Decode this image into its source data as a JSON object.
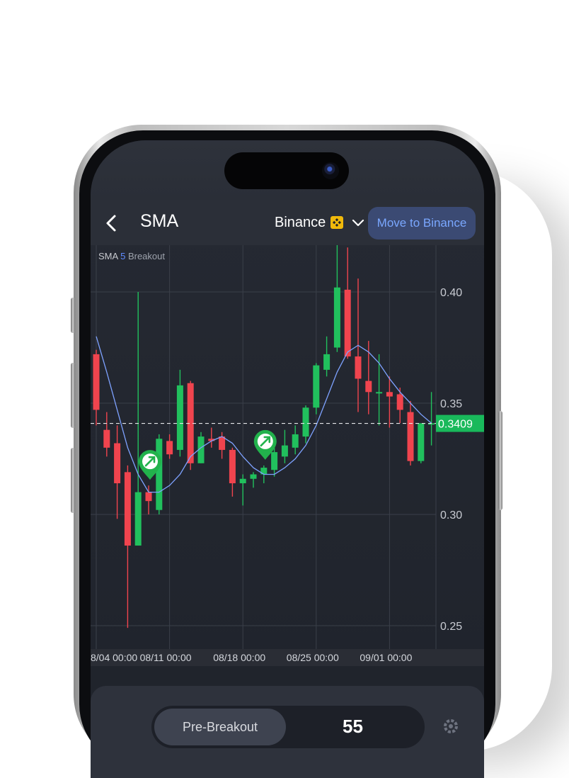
{
  "header": {
    "title": "SMA",
    "exchange": "Binance",
    "move_button": "Move to Binance"
  },
  "indicator": {
    "name": "SMA",
    "period": "5",
    "mode": "Breakout"
  },
  "bottom_panel": {
    "active_segment": "Pre-Breakout",
    "right_value": "55"
  },
  "colors": {
    "up": "#21c05d",
    "down": "#f0444e",
    "sma_line": "#7ea2ff",
    "current_price_tag": "#19b95b",
    "accent": "#7aa7ff"
  },
  "icons": [
    "back-icon",
    "binance-icon",
    "chevron-down-icon",
    "buy-signal-icon",
    "gear-icon"
  ],
  "chart_data": {
    "type": "candlestick",
    "title": "",
    "y_ticks": [
      "0.40",
      "0.35",
      "0.30",
      "0.25"
    ],
    "ylim": [
      0.245,
      0.455
    ],
    "x_ticks": [
      {
        "label": "8/04 00:00",
        "index": 0
      },
      {
        "label": "08/11 00:00",
        "index": 7
      },
      {
        "label": "08/18 00:00",
        "index": 14
      },
      {
        "label": "08/25 00:00",
        "index": 21
      },
      {
        "label": "09/01 00:00",
        "index": 28
      }
    ],
    "current_price": "0.3409",
    "candles": [
      {
        "o": 0.372,
        "h": 0.374,
        "l": 0.34,
        "c": 0.347
      },
      {
        "o": 0.338,
        "h": 0.346,
        "l": 0.326,
        "c": 0.33
      },
      {
        "o": 0.332,
        "h": 0.34,
        "l": 0.298,
        "c": 0.314
      },
      {
        "o": 0.319,
        "h": 0.322,
        "l": 0.249,
        "c": 0.286
      },
      {
        "o": 0.286,
        "h": 0.4,
        "l": 0.286,
        "c": 0.31
      },
      {
        "o": 0.31,
        "h": 0.313,
        "l": 0.3,
        "c": 0.306
      },
      {
        "o": 0.302,
        "h": 0.336,
        "l": 0.3,
        "c": 0.334
      },
      {
        "o": 0.333,
        "h": 0.336,
        "l": 0.325,
        "c": 0.327
      },
      {
        "o": 0.329,
        "h": 0.365,
        "l": 0.326,
        "c": 0.358
      },
      {
        "o": 0.359,
        "h": 0.36,
        "l": 0.32,
        "c": 0.323
      },
      {
        "o": 0.323,
        "h": 0.337,
        "l": 0.323,
        "c": 0.335
      },
      {
        "o": 0.334,
        "h": 0.339,
        "l": 0.33,
        "c": 0.333
      },
      {
        "o": 0.335,
        "h": 0.337,
        "l": 0.325,
        "c": 0.329
      },
      {
        "o": 0.329,
        "h": 0.33,
        "l": 0.308,
        "c": 0.314
      },
      {
        "o": 0.314,
        "h": 0.318,
        "l": 0.304,
        "c": 0.316
      },
      {
        "o": 0.316,
        "h": 0.319,
        "l": 0.312,
        "c": 0.318
      },
      {
        "o": 0.318,
        "h": 0.322,
        "l": 0.314,
        "c": 0.321
      },
      {
        "o": 0.32,
        "h": 0.33,
        "l": 0.317,
        "c": 0.328
      },
      {
        "o": 0.326,
        "h": 0.338,
        "l": 0.323,
        "c": 0.331
      },
      {
        "o": 0.33,
        "h": 0.34,
        "l": 0.327,
        "c": 0.336
      },
      {
        "o": 0.335,
        "h": 0.349,
        "l": 0.332,
        "c": 0.348
      },
      {
        "o": 0.348,
        "h": 0.368,
        "l": 0.345,
        "c": 0.367
      },
      {
        "o": 0.365,
        "h": 0.38,
        "l": 0.362,
        "c": 0.372
      },
      {
        "o": 0.375,
        "h": 0.455,
        "l": 0.373,
        "c": 0.402
      },
      {
        "o": 0.401,
        "h": 0.42,
        "l": 0.37,
        "c": 0.371
      },
      {
        "o": 0.371,
        "h": 0.406,
        "l": 0.346,
        "c": 0.361
      },
      {
        "o": 0.36,
        "h": 0.378,
        "l": 0.345,
        "c": 0.355
      },
      {
        "o": 0.355,
        "h": 0.372,
        "l": 0.34,
        "c": 0.355
      },
      {
        "o": 0.355,
        "h": 0.362,
        "l": 0.339,
        "c": 0.353
      },
      {
        "o": 0.354,
        "h": 0.357,
        "l": 0.341,
        "c": 0.347
      },
      {
        "o": 0.346,
        "h": 0.351,
        "l": 0.322,
        "c": 0.324
      },
      {
        "o": 0.324,
        "h": 0.34,
        "l": 0.323,
        "c": 0.341
      },
      {
        "o": 0.341,
        "h": 0.355,
        "l": 0.331,
        "c": 0.341
      }
    ],
    "sma_values": [
      0.38,
      0.364,
      0.347,
      0.33,
      0.318,
      0.31,
      0.31,
      0.313,
      0.318,
      0.326,
      0.33,
      0.333,
      0.335,
      0.332,
      0.326,
      0.321,
      0.318,
      0.318,
      0.321,
      0.325,
      0.331,
      0.34,
      0.352,
      0.364,
      0.373,
      0.376,
      0.373,
      0.368,
      0.361,
      0.355,
      0.35,
      0.345,
      0.341
    ],
    "signals": [
      {
        "index": 5,
        "label": "buy"
      },
      {
        "index": 16,
        "label": "buy"
      }
    ]
  }
}
